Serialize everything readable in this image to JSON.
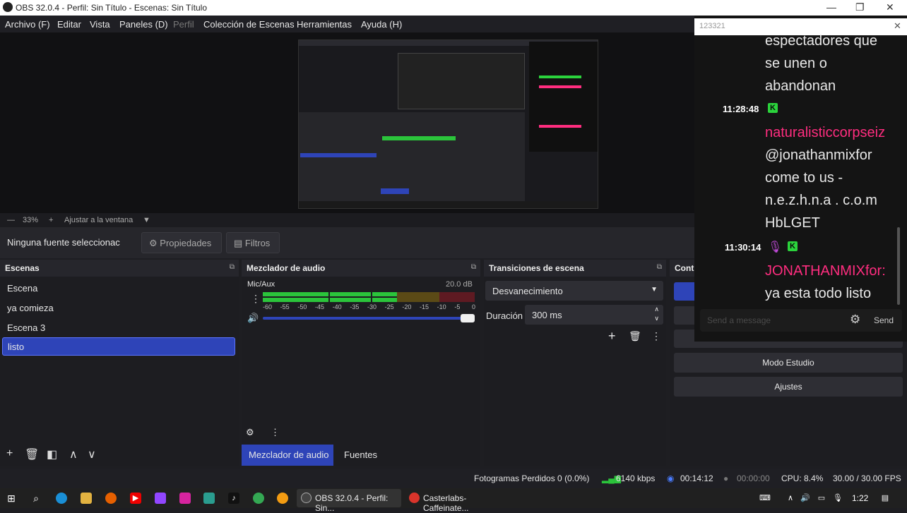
{
  "window": {
    "title": "OBS 32.0.4 - Perfil: Sin Título - Escenas: Sin Título"
  },
  "menu": {
    "items": [
      "Archivo (F)",
      "Editar",
      "Vista",
      "Paneles (D)",
      "Perfil",
      "Colección de Escenas",
      "Herramientas",
      "Ayuda (H)"
    ]
  },
  "preview": {
    "zoom": "33%",
    "fit_label": "Ajustar a la ventana"
  },
  "source_toolbar": {
    "no_source": "Ninguna fuente seleccionac",
    "properties": "Propiedades",
    "filters": "Filtros"
  },
  "scenes": {
    "title": "Escenas",
    "items": [
      "Escena",
      "ya comieza",
      "Escena 3",
      "listo"
    ],
    "selected_index": 3
  },
  "audio_mixer": {
    "title": "Mezclador de audio",
    "channel_name": "Mic/Aux",
    "level": "20.0 dB",
    "ticks": [
      "-60",
      "-55",
      "-50",
      "-45",
      "-40",
      "-35",
      "-30",
      "-25",
      "-20",
      "-15",
      "-10",
      "-5",
      "0"
    ],
    "tab_mixer": "Mezclador de audio",
    "tab_sources": "Fuentes"
  },
  "transitions": {
    "title": "Transiciones de escena",
    "selected": "Desvanecimiento",
    "duration_label": "Duración",
    "duration_value": "300 ms"
  },
  "controls": {
    "title": "Cont",
    "studio_mode": "Modo Estudio",
    "settings": "Ajustes"
  },
  "status": {
    "dropped_frames": "Fotogramas Perdidos 0 (0.0%)",
    "bitrate": "6140 kbps",
    "stream_time": "00:14:12",
    "record_time": "00:00:00",
    "cpu": "CPU: 8.4%",
    "fps": "30.00 / 30.00 FPS"
  },
  "chat": {
    "header_value": "123321",
    "messages": [
      {
        "text": "espectadores que"
      },
      {
        "text": "se unen o"
      },
      {
        "text": "abandonan"
      },
      {
        "time": "11:28:48",
        "user": "naturalisticcorpseiz",
        "lines": [
          "@jonathanmixfor",
          "come to us -",
          "n.e.z.h.n.a . c.o.m",
          "HbLGET"
        ]
      },
      {
        "time": "11:30:14",
        "user": "JONATHANMIXfor:",
        "lines": [
          "ya esta todo listo"
        ]
      }
    ],
    "input_placeholder": "Send a message",
    "send_label": "Send"
  },
  "taskbar": {
    "obs_app": "OBS 32.0.4 - Perfil: Sin...",
    "casterlabs_app": "Casterlabs-Caffeinate...",
    "clock": "1:22"
  },
  "colors": {
    "accent": "#2e44b8",
    "chat_name": "#ff2d7f",
    "badge": "#2bd33c",
    "meter_green": "#2bc43b",
    "meter_yellow": "#c9a21c",
    "meter_red": "#c8222f"
  }
}
